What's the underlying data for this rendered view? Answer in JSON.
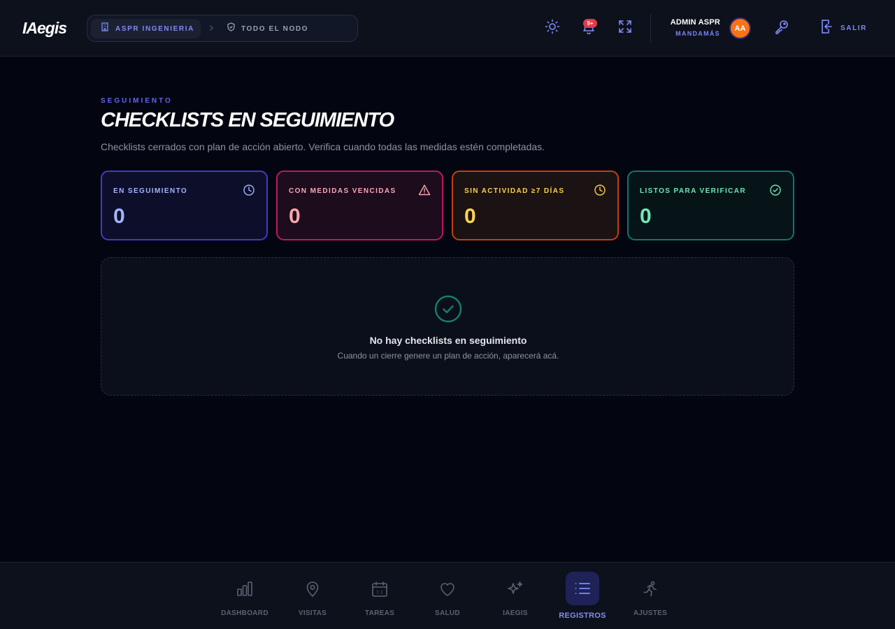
{
  "header": {
    "logo": "IAegis",
    "org_label": "ASPR INGENIERIA",
    "node_label": "TODO EL NODO",
    "notifications_badge": "9+",
    "user_name": "ADMIN ASPR",
    "user_role": "MANDAMÁS",
    "avatar_initials": "AA",
    "logout_label": "SALIR",
    "icons": [
      "theme-sun-icon",
      "bell-icon",
      "fullscreen-icon",
      "key-icon",
      "logout-icon"
    ]
  },
  "page": {
    "eyebrow": "SEGUIMIENTO",
    "title": "CHECKLISTS EN SEGUIMIENTO",
    "subtitle": "Checklists cerrados con plan de acción abierto. Verifica cuando todas las medidas estén completadas."
  },
  "stats": [
    {
      "label": "EN SEGUIMIENTO",
      "value": "0",
      "icon": "clock-icon",
      "color": "#a5b4fc"
    },
    {
      "label": "CON MEDIDAS VENCIDAS",
      "value": "0",
      "icon": "warning-icon",
      "color": "#fda4af"
    },
    {
      "label": "SIN ACTIVIDAD ≥7 DÍAS",
      "value": "0",
      "icon": "clock-icon",
      "color": "#fcd34d"
    },
    {
      "label": "LISTOS PARA VERIFICAR",
      "value": "0",
      "icon": "check-circle-icon",
      "color": "#6ee7b7"
    }
  ],
  "empty_state": {
    "title": "No hay checklists en seguimiento",
    "subtitle": "Cuando un cierre genere un plan de acción, aparecerá acá."
  },
  "bottom_nav": [
    {
      "label": "DASHBOARD",
      "icon": "bar-chart-icon",
      "active": false
    },
    {
      "label": "VISITAS",
      "icon": "map-pin-icon",
      "active": false
    },
    {
      "label": "TAREAS",
      "icon": "calendar-icon",
      "active": false
    },
    {
      "label": "SALUD",
      "icon": "heart-icon",
      "active": false
    },
    {
      "label": "IAEGIS",
      "icon": "sparkles-icon",
      "active": false
    },
    {
      "label": "REGISTROS",
      "icon": "list-icon",
      "active": true
    },
    {
      "label": "AJUSTES",
      "icon": "runner-icon",
      "active": false
    }
  ],
  "colors": {
    "accent": "#6366f1",
    "background": "#030610",
    "topbar": "#0c111c"
  }
}
